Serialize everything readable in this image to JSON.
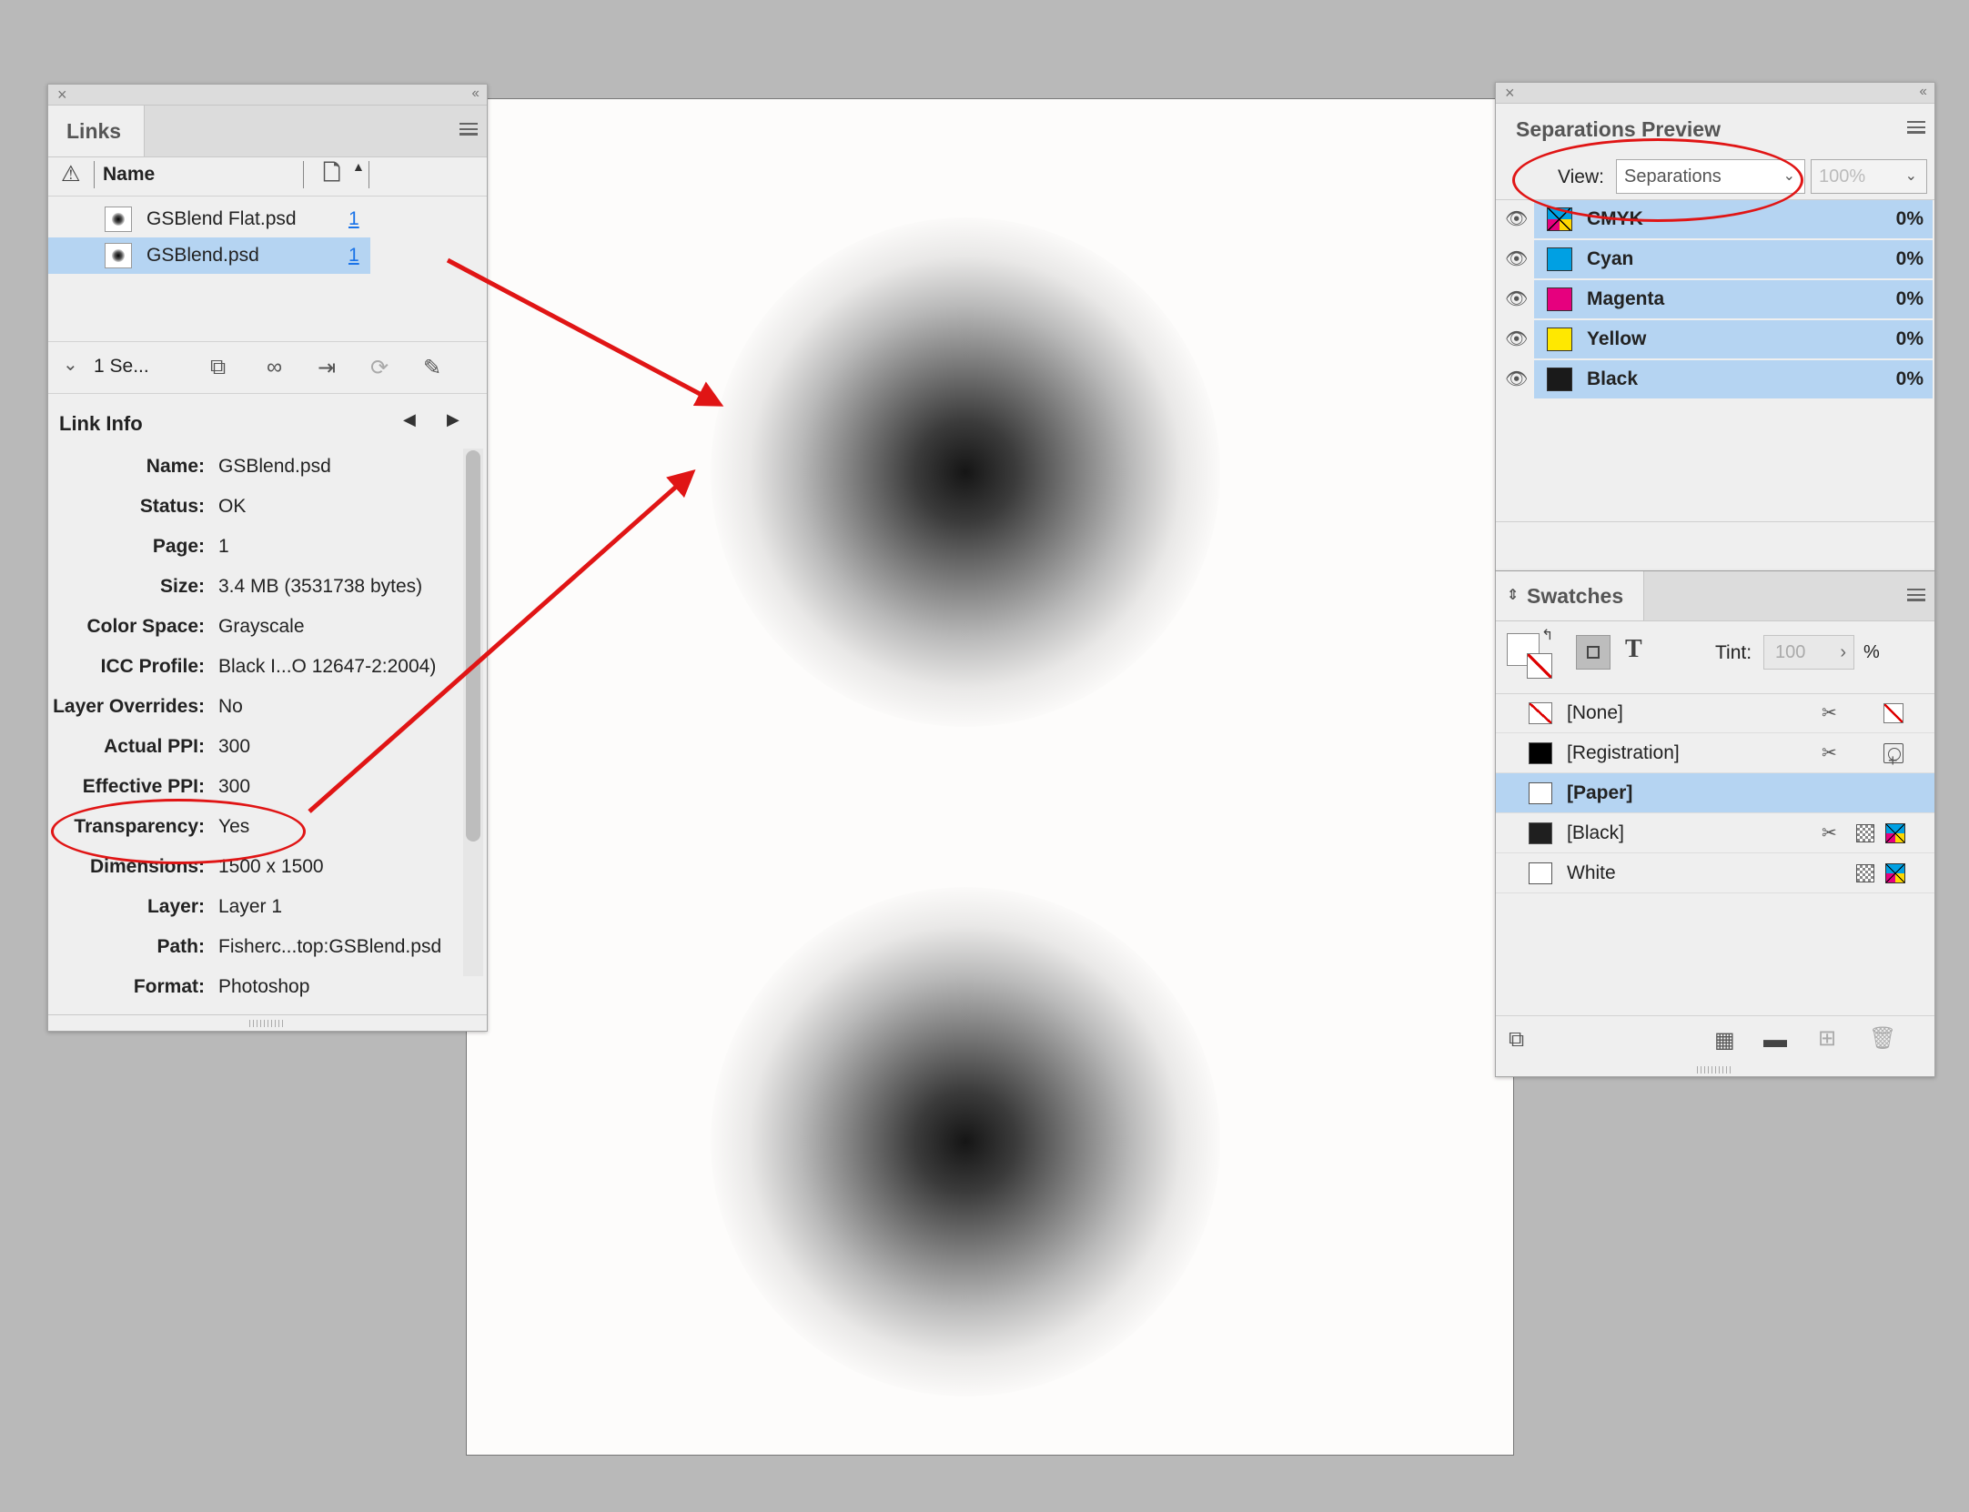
{
  "links_panel": {
    "tab_label": "Links",
    "column_name": "Name",
    "items": [
      {
        "name": "GSBlend Flat.psd",
        "page": "1",
        "selected": false
      },
      {
        "name": "GSBlend.psd",
        "page": "1",
        "selected": true
      }
    ],
    "selection_label": "1 Se...",
    "link_info_title": "Link Info",
    "info": [
      {
        "key": "Name:",
        "value": "GSBlend.psd"
      },
      {
        "key": "Status:",
        "value": "OK"
      },
      {
        "key": "Page:",
        "value": "1"
      },
      {
        "key": "Size:",
        "value": "3.4 MB (3531738 bytes)"
      },
      {
        "key": "Color Space:",
        "value": "Grayscale"
      },
      {
        "key": "ICC Profile:",
        "value": "Black I...O 12647-2:2004)"
      },
      {
        "key": "Layer Overrides:",
        "value": "No"
      },
      {
        "key": "Actual PPI:",
        "value": "300"
      },
      {
        "key": "Effective PPI:",
        "value": "300"
      },
      {
        "key": "Transparency:",
        "value": "Yes"
      },
      {
        "key": "Dimensions:",
        "value": "1500 x 1500"
      },
      {
        "key": "Layer:",
        "value": "Layer 1"
      },
      {
        "key": "Path:",
        "value": "Fisherc...top:GSBlend.psd"
      },
      {
        "key": "Format:",
        "value": "Photoshop"
      }
    ]
  },
  "separations_panel": {
    "tab_label": "Separations Preview",
    "view_label": "View:",
    "view_value": "Separations",
    "zoom_value": "100%",
    "plates": [
      {
        "name": "CMYK",
        "percent": "0%",
        "color": "cmyk"
      },
      {
        "name": "Cyan",
        "percent": "0%",
        "color": "#00a0e3"
      },
      {
        "name": "Magenta",
        "percent": "0%",
        "color": "#e6007e"
      },
      {
        "name": "Yellow",
        "percent": "0%",
        "color": "#ffe800"
      },
      {
        "name": "Black",
        "percent": "0%",
        "color": "#1a1a1a"
      }
    ]
  },
  "swatches_panel": {
    "tab_label": "Swatches",
    "tint_label": "Tint:",
    "tint_value": "100",
    "tint_unit": "%",
    "text_glyph": "T",
    "swatches": [
      {
        "name": "[None]",
        "chip": "none",
        "selected": false
      },
      {
        "name": "[Registration]",
        "chip": "#000000",
        "selected": false
      },
      {
        "name": "[Paper]",
        "chip": "#ffffff",
        "selected": true
      },
      {
        "name": "[Black]",
        "chip": "#1f1f1f",
        "selected": false
      },
      {
        "name": "White",
        "chip": "#ffffff",
        "selected": false
      }
    ]
  },
  "colors": {
    "selection": "#b5d4f2",
    "annotation": "#e01515",
    "link": "#1a73e8"
  }
}
